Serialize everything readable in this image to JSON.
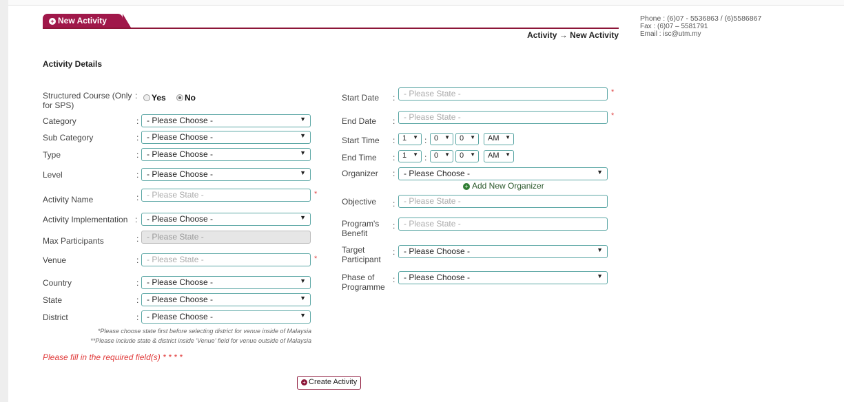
{
  "contact": {
    "phone": "Phone : (6)07 - 5536863 / (6)5586867",
    "fax": "Fax : (6)07 – 5581791",
    "email": "Email : isc@utm.my"
  },
  "tab": {
    "label": "New Activity"
  },
  "breadcrumb": "Activity → New Activity",
  "section_title": "Activity Details",
  "left": {
    "structured": {
      "label": "Structured Course (Only for SPS)",
      "yes": "Yes",
      "no": "No",
      "selected": "No"
    },
    "category": {
      "label": "Category",
      "value": "- Please Choose -"
    },
    "sub_category": {
      "label": "Sub Category",
      "value": "- Please Choose -"
    },
    "type": {
      "label": "Type",
      "value": "- Please Choose -"
    },
    "level": {
      "label": "Level",
      "value": "- Please Choose -"
    },
    "activity_name": {
      "label": "Activity Name",
      "placeholder": "- Please State -"
    },
    "implementation": {
      "label": "Activity Implementation",
      "value": "- Please Choose -"
    },
    "max_participants": {
      "label": "Max Participants",
      "placeholder": "- Please State -"
    },
    "venue": {
      "label": "Venue",
      "placeholder": "- Please State -"
    },
    "country": {
      "label": "Country",
      "value": "- Please Choose -"
    },
    "state": {
      "label": "State",
      "value": "- Please Choose -"
    },
    "district": {
      "label": "District",
      "value": "- Please Choose -"
    }
  },
  "right": {
    "start_date": {
      "label": "Start Date",
      "placeholder": "- Please State -"
    },
    "end_date": {
      "label": "End Date",
      "placeholder": "- Please State -"
    },
    "start_time": {
      "label": "Start Time",
      "hour": "1",
      "min1": "0",
      "min2": "0",
      "ampm": "AM"
    },
    "end_time": {
      "label": "End Time",
      "hour": "1",
      "min1": "0",
      "min2": "0",
      "ampm": "AM"
    },
    "organizer": {
      "label": "Organizer",
      "value": "- Please Choose -",
      "add_link": "Add New Organizer"
    },
    "objective": {
      "label": "Objective",
      "placeholder": "- Please State -"
    },
    "benefit": {
      "label_1": "Program's",
      "label_2": "Benefit",
      "placeholder": "- Please State -"
    },
    "target": {
      "label_1": "Target",
      "label_2": "Participant",
      "value": "- Please Choose -"
    },
    "phase": {
      "label_1": "Phase of",
      "label_2": "Programme",
      "value": "- Please Choose -"
    }
  },
  "notes": {
    "note1": "*Please choose state first before selecting district for venue inside of Malaysia",
    "note2": "**Please include state & district inside 'Venue' field for venue outside of Malaysia"
  },
  "required_msg": "Please fill in the required field(s) * * * *",
  "required_mark": "*",
  "colon": ":",
  "icons": {
    "plus": "+",
    "arrow": "▼"
  },
  "create_button": "Create Activity",
  "colors": {
    "brand": "#a0184a",
    "input_border": "#5aa6a4",
    "required": "#e04a4a"
  }
}
